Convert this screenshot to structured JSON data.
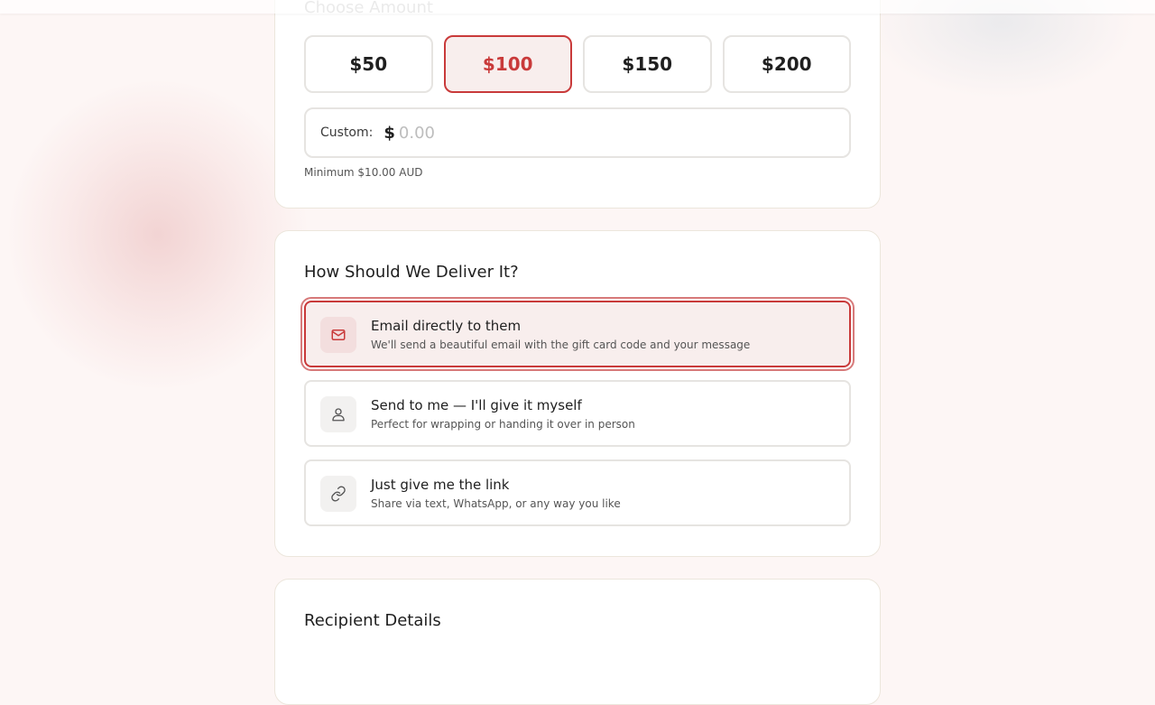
{
  "amount_section": {
    "title": "Choose Amount",
    "options": [
      "$50",
      "$100",
      "$150",
      "$200"
    ],
    "selected": "$100",
    "custom_label": "Custom:",
    "currency_symbol": "$",
    "custom_placeholder": "0.00",
    "hint": "Minimum $10.00 AUD"
  },
  "delivery_section": {
    "title": "How Should We Deliver It?",
    "options": [
      {
        "title": "Email directly to them",
        "description": "We'll send a beautiful email with the gift card code and your message",
        "icon": "mail-icon",
        "selected": true
      },
      {
        "title": "Send to me — I'll give it myself",
        "description": "Perfect for wrapping or handing it over in person",
        "icon": "user-icon",
        "selected": false
      },
      {
        "title": "Just give me the link",
        "description": "Share via text, WhatsApp, or any way you like",
        "icon": "link-icon",
        "selected": false
      }
    ]
  },
  "recipient_section": {
    "title": "Recipient Details"
  },
  "colors": {
    "accent": "#c93a3a",
    "selected_bg": "#f8eeed",
    "page_bg": "#fdf6f5"
  }
}
